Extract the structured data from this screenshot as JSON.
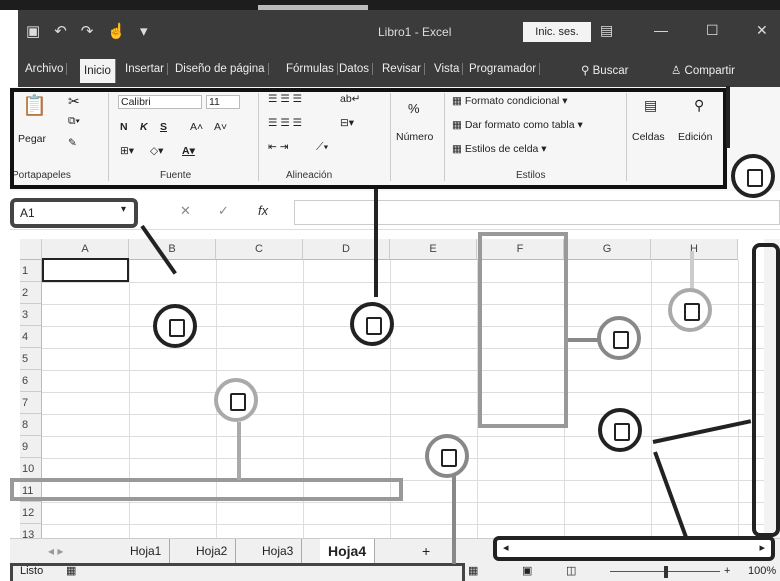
{
  "titlebar": {
    "title": "Libro1 - Excel",
    "signin": "Inic. ses."
  },
  "tabs": [
    "Archivo",
    "Inicio",
    "Insertar",
    "Diseño de página",
    "Fórmulas",
    "Datos",
    "Revisar",
    "Vista",
    "Programador",
    "Buscar",
    "Compartir"
  ],
  "ribbon": {
    "paste": "Pegar",
    "font_name": "Calibri",
    "font_size": "11",
    "bold": "N",
    "italic": "K",
    "underline": "S",
    "numero": "Número",
    "percent": "%",
    "formato_condicional": "Formato condicional",
    "dar_formato": "Dar formato como tabla",
    "estilos_celda": "Estilos de celda",
    "celdas": "Celdas",
    "edicion": "Edición",
    "groups": [
      "Portapapeles",
      "Fuente",
      "Alineación",
      "Estilos"
    ]
  },
  "formula": {
    "namebox": "A1",
    "fx": "fx"
  },
  "columns": [
    "A",
    "B",
    "C",
    "D",
    "E",
    "F",
    "G",
    "H"
  ],
  "rows": [
    "1",
    "2",
    "3",
    "4",
    "5",
    "6",
    "7",
    "8",
    "9",
    "10",
    "11",
    "12",
    "13"
  ],
  "sheets": [
    "Hoja1",
    "Hoja2",
    "Hoja3",
    "Hoja4"
  ],
  "active_sheet": "Hoja4",
  "add_sheet": "+",
  "status": {
    "ready": "Listo",
    "zoom": "100%"
  }
}
